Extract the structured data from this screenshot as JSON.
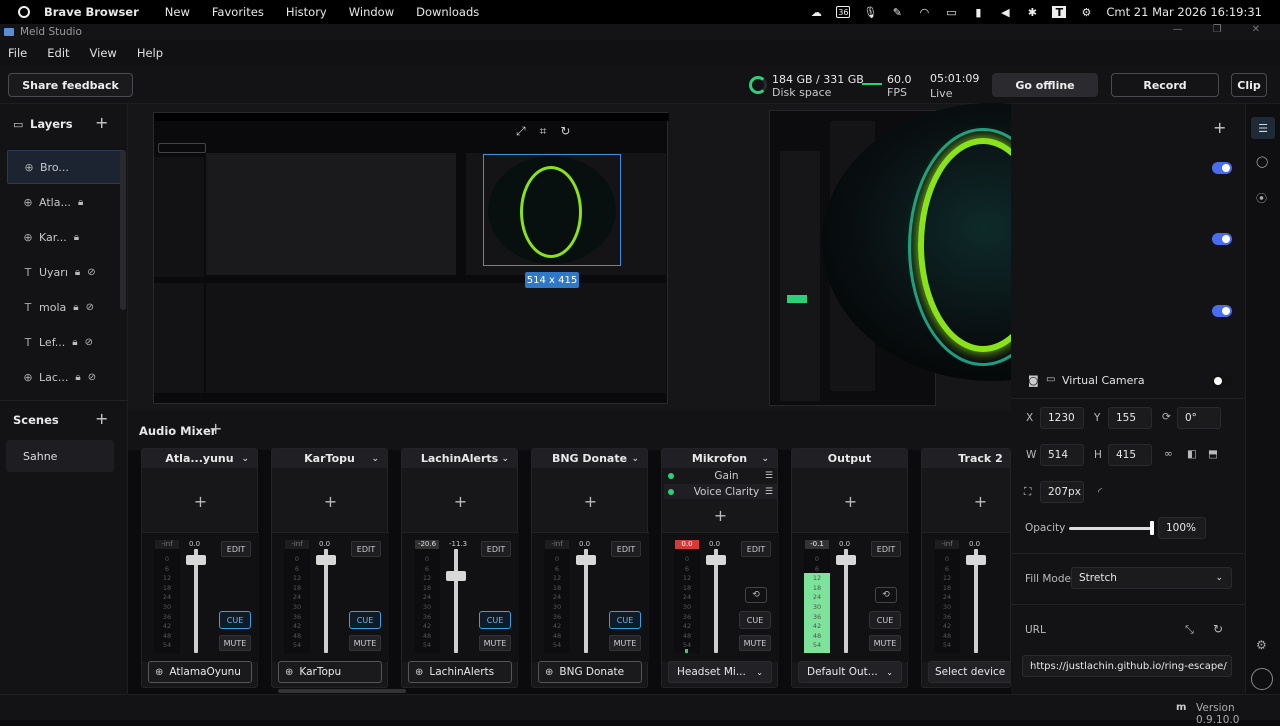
{
  "os": {
    "app_name": "Brave Browser",
    "menus": [
      "New",
      "Favorites",
      "History",
      "Window",
      "Downloads"
    ],
    "tray_battery": "36",
    "clock": "Cmt 21 Mar 2026 16:19:31"
  },
  "window": {
    "title": "Meld Studio"
  },
  "menubar": [
    "File",
    "Edit",
    "View",
    "Help"
  ],
  "toolbar": {
    "feedback": "Share feedback",
    "disk_value": "184 GB / 331 GB",
    "disk_label": "Disk space",
    "fps_value": "60.0",
    "fps_label": "FPS",
    "live_time": "05:01:09",
    "live_label": "Live",
    "go_offline": "Go offline",
    "record": "Record",
    "clip": "Clip"
  },
  "layers": {
    "title": "Layers",
    "items": [
      {
        "icon": "globe",
        "name": "Bro..."
      },
      {
        "icon": "globe",
        "name": "Atla..."
      },
      {
        "icon": "globe",
        "name": "Kar..."
      },
      {
        "icon": "text",
        "name": "Uyarı"
      },
      {
        "icon": "text",
        "name": "mola"
      },
      {
        "icon": "text",
        "name": "Lef..."
      },
      {
        "icon": "globe",
        "name": "Lac..."
      }
    ]
  },
  "scenes": {
    "title": "Scenes",
    "items": [
      "Sahne"
    ]
  },
  "preview": {
    "size_tag": "514 x 415"
  },
  "mixer": {
    "title": "Audio Mixer",
    "channels": [
      {
        "name": "Atla...yunu",
        "meter": "-inf",
        "fader": "0.0",
        "cue_active": true,
        "source": "AtlamaOyunu",
        "source_type": "globe"
      },
      {
        "name": "KarTopu",
        "meter": "-inf",
        "fader": "0.0",
        "cue_active": true,
        "source": "KarTopu",
        "source_type": "globe"
      },
      {
        "name": "LachinAlerts",
        "meter": "-20.6",
        "fader": "-11.3",
        "cue_active": true,
        "source": "LachinAlerts",
        "source_type": "globe"
      },
      {
        "name": "BNG Donate",
        "meter": "-inf",
        "fader": "0.0",
        "cue_active": true,
        "source": "BNG Donate",
        "source_type": "globe"
      },
      {
        "name": "Mikrofon",
        "meter": "0.0",
        "fader": "0.0",
        "cue_active": false,
        "source": "Headset Mi...",
        "source_type": "device",
        "effects": [
          "Gain",
          "Voice Clarity"
        ]
      },
      {
        "name": "Output",
        "meter": "-0.1",
        "fader": "0.0",
        "cue_active": false,
        "source": "Default Out...",
        "source_type": "device"
      },
      {
        "name": "Track 2",
        "meter": "-inf",
        "fader": "0.0",
        "cue_active": false,
        "source": "Select device",
        "source_type": "device"
      }
    ],
    "meter_scale": [
      "0",
      "6",
      "12",
      "18",
      "24",
      "30",
      "36",
      "42",
      "48",
      "54"
    ],
    "buttons": {
      "edit": "EDIT",
      "cue": "CUE",
      "mute": "MUTE"
    }
  },
  "properties": {
    "virtual_camera": "Virtual Camera",
    "x_label": "X",
    "x": "1230",
    "y_label": "Y",
    "y": "155",
    "rot": "0°",
    "w_label": "W",
    "w": "514",
    "h_label": "H",
    "h": "415",
    "radius": "207px",
    "opacity_label": "Opacity",
    "opacity": "100%",
    "fill_label": "Fill Mode",
    "fill_mode": "Stretch",
    "url_label": "URL",
    "url": "https://justlachin.github.io/ring-escape/"
  },
  "status": {
    "version": "Version 0.9.10.0"
  },
  "colors": {
    "accent": "#4a6cf0",
    "meter_green": "#2bd07b",
    "cue_blue": "#3a9ee8",
    "selection": "#3a8ee0"
  }
}
